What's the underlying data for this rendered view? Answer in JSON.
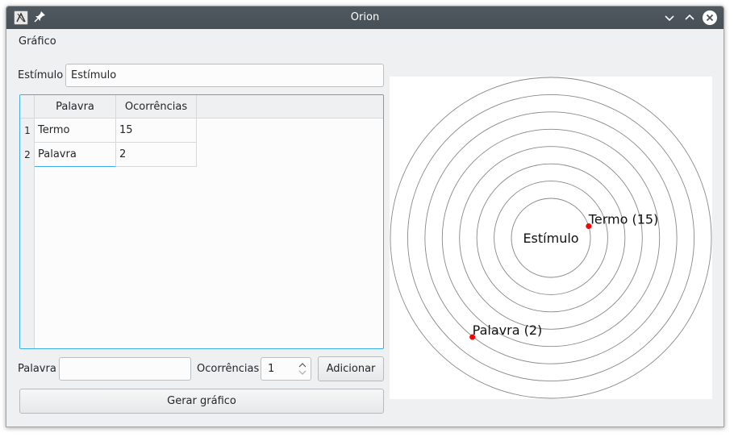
{
  "window": {
    "title": "Orion"
  },
  "menu": {
    "items": [
      {
        "label": "Gráfico"
      }
    ]
  },
  "stimulus": {
    "label": "Estímulo",
    "value": "Estímulo"
  },
  "table": {
    "headers": [
      "Palavra",
      "Ocorrências"
    ],
    "rows": [
      {
        "num": "1",
        "palavra": "Termo",
        "ocorrencias": "15"
      },
      {
        "num": "2",
        "palavra": "Palavra",
        "ocorrencias": "2"
      }
    ]
  },
  "form": {
    "palavra_label": "Palavra",
    "palavra_value": "",
    "ocorrencias_label": "Ocorrências",
    "ocorrencias_value": "1",
    "add_button": "Adicionar",
    "generate_button": "Gerar gráfico"
  },
  "chart_data": {
    "type": "scatter",
    "center_label": "Estímulo",
    "rings": 8,
    "points": [
      {
        "label": "Termo (15)",
        "word": "Termo",
        "occurrences": 15
      },
      {
        "label": "Palavra (2)",
        "word": "Palavra",
        "occurrences": 2
      }
    ],
    "point_color": "#ff0000",
    "ring_color": "#888888"
  }
}
